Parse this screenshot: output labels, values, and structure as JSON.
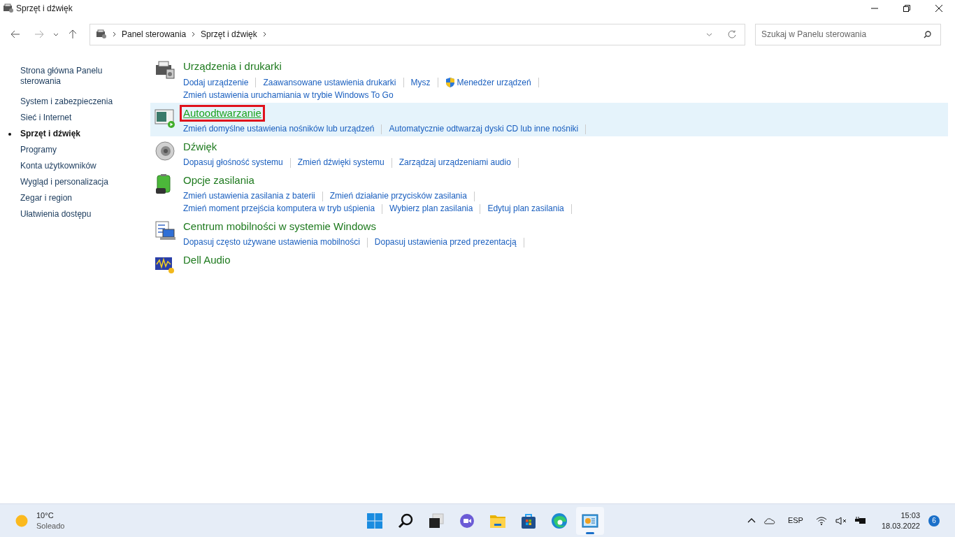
{
  "window": {
    "title": "Sprzęt i dźwięk"
  },
  "address_bar": {
    "crumbs": [
      "Panel sterowania",
      "Sprzęt i dźwięk"
    ]
  },
  "search": {
    "placeholder": "Szukaj w Panelu sterowania"
  },
  "sidebar": {
    "items": [
      {
        "label": "Strona główna Panelu sterowania",
        "selected": false
      },
      {
        "label": "System i zabezpieczenia",
        "selected": false
      },
      {
        "label": "Sieć i Internet",
        "selected": false
      },
      {
        "label": "Sprzęt i dźwięk",
        "selected": true
      },
      {
        "label": "Programy",
        "selected": false
      },
      {
        "label": "Konta użytkowników",
        "selected": false
      },
      {
        "label": "Wygląd i personalizacja",
        "selected": false
      },
      {
        "label": "Zegar i region",
        "selected": false
      },
      {
        "label": "Ułatwienia dostępu",
        "selected": false
      }
    ]
  },
  "categories": [
    {
      "kind": "printer",
      "title": "Urządzenia i drukarki",
      "hovered": false,
      "highlighted": false,
      "lines": [
        [
          {
            "text": "Dodaj urządzenie",
            "shield": false
          },
          {
            "text": "Zaawansowane ustawienia drukarki",
            "shield": false
          },
          {
            "text": "Mysz",
            "shield": false
          },
          {
            "text": "Menedżer urządzeń",
            "shield": true
          }
        ],
        [
          {
            "text": "Zmień ustawienia uruchamiania w trybie Windows To Go",
            "shield": false
          }
        ]
      ]
    },
    {
      "kind": "autoplay",
      "title": "Autoodtwarzanie",
      "hovered": true,
      "highlighted": true,
      "lines": [
        [
          {
            "text": "Zmień domyślne ustawienia nośników lub urządzeń",
            "shield": false
          },
          {
            "text": "Automatycznie odtwarzaj dyski CD lub inne nośniki",
            "shield": false
          }
        ]
      ]
    },
    {
      "kind": "speaker",
      "title": "Dźwięk",
      "hovered": false,
      "highlighted": false,
      "lines": [
        [
          {
            "text": "Dopasuj głośność systemu",
            "shield": false
          },
          {
            "text": "Zmień dźwięki systemu",
            "shield": false
          },
          {
            "text": "Zarządzaj urządzeniami audio",
            "shield": false
          }
        ]
      ]
    },
    {
      "kind": "battery",
      "title": "Opcje zasilania",
      "hovered": false,
      "highlighted": false,
      "lines": [
        [
          {
            "text": "Zmień ustawienia zasilania z baterii",
            "shield": false
          },
          {
            "text": "Zmień działanie przycisków zasilania",
            "shield": false
          }
        ],
        [
          {
            "text": "Zmień moment przejścia komputera w tryb uśpienia",
            "shield": false
          },
          {
            "text": "Wybierz plan zasilania",
            "shield": false
          },
          {
            "text": "Edytuj plan zasilania",
            "shield": false
          }
        ]
      ]
    },
    {
      "kind": "mobility",
      "title": "Centrum mobilności w systemie Windows",
      "hovered": false,
      "highlighted": false,
      "lines": [
        [
          {
            "text": "Dopasuj często używane ustawienia mobilności",
            "shield": false
          },
          {
            "text": "Dopasuj ustawienia przed prezentacją",
            "shield": false
          }
        ]
      ]
    },
    {
      "kind": "audio",
      "title": "Dell Audio",
      "hovered": false,
      "highlighted": false
    }
  ],
  "taskbar": {
    "weather": {
      "temperature": "10°C",
      "condition": "Soleado"
    },
    "apps": [
      {
        "kind": "start",
        "active": false
      },
      {
        "kind": "search",
        "active": false
      },
      {
        "kind": "taskview",
        "active": false
      },
      {
        "kind": "chat",
        "active": false
      },
      {
        "kind": "explorer",
        "active": false
      },
      {
        "kind": "store",
        "active": false
      },
      {
        "kind": "edge",
        "active": false
      },
      {
        "kind": "controlpanel",
        "active": true
      }
    ],
    "language": "ESP",
    "time": "15:03",
    "date": "18.03.2022",
    "notifications": "6"
  }
}
